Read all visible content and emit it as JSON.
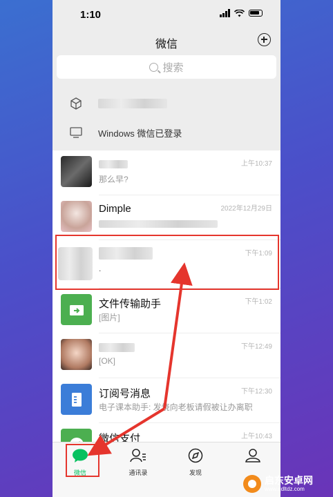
{
  "status_bar": {
    "time": "1:10"
  },
  "header": {
    "title": "微信"
  },
  "search": {
    "placeholder": "搜索"
  },
  "info_rows": [
    {
      "text": ""
    },
    {
      "text": "Windows 微信已登录"
    }
  ],
  "chats": [
    {
      "name": "",
      "preview": "那么早?",
      "time": "上午10:37"
    },
    {
      "name": "Dimple",
      "preview": "",
      "time": "2022年12月29日"
    },
    {
      "name": "",
      "preview": ".",
      "time": "下午1:09"
    },
    {
      "name": "文件传输助手",
      "preview": "[图片]",
      "time": "下午1:02"
    },
    {
      "name": "",
      "preview": "[OK]",
      "time": "下午12:49"
    },
    {
      "name": "订阅号消息",
      "preview": "电子课本助手: 发烧向老板请假被让办离职",
      "time": "下午12:30"
    },
    {
      "name": "微信支付",
      "preview": "",
      "time": "上午10:43"
    }
  ],
  "tabbar": {
    "tabs": [
      {
        "label": "微信",
        "active": true
      },
      {
        "label": "通讯录",
        "active": false
      },
      {
        "label": "发现",
        "active": false
      },
      {
        "label": "我",
        "active": false
      }
    ]
  },
  "watermark": {
    "title": "启东安卓网",
    "url": "www.qdltdz.com"
  },
  "colors": {
    "accent": "#07c160",
    "annotation": "#e5352d",
    "file_transfer": "#4caf50",
    "subscription": "#3b7dd8"
  }
}
